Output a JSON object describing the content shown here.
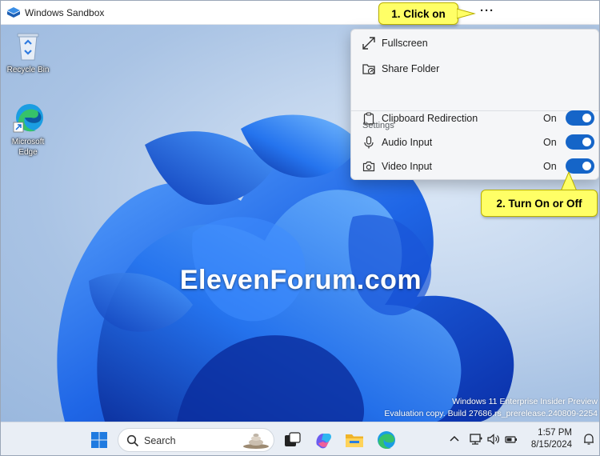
{
  "window": {
    "title": "Windows Sandbox"
  },
  "menu": {
    "items": [
      {
        "label": "Fullscreen",
        "icon": "expand-icon"
      },
      {
        "label": "Share Folder",
        "icon": "share-folder-icon"
      }
    ],
    "settings_heading": "Settings",
    "settings": [
      {
        "label": "Clipboard Redirection",
        "state": "On",
        "icon": "clipboard-icon"
      },
      {
        "label": "Audio Input",
        "state": "On",
        "icon": "microphone-icon"
      },
      {
        "label": "Video Input",
        "state": "On",
        "icon": "camera-icon"
      }
    ]
  },
  "callouts": {
    "step1": "1. Click on",
    "step2": "2. Turn On or Off"
  },
  "desktop": {
    "icons": [
      {
        "label": "Recycle Bin"
      },
      {
        "label": "Microsoft Edge"
      }
    ],
    "watermark": "ElevenForum.com",
    "build_line1": "Windows 11 Enterprise Insider Preview",
    "build_line2": "Evaluation copy. Build 27686.rs_prerelease.240809-2254"
  },
  "taskbar": {
    "search_label": "Search",
    "time": "1:57 PM",
    "date": "8/15/2024"
  },
  "colors": {
    "accent": "#1565c8",
    "callout": "#ffff66"
  }
}
